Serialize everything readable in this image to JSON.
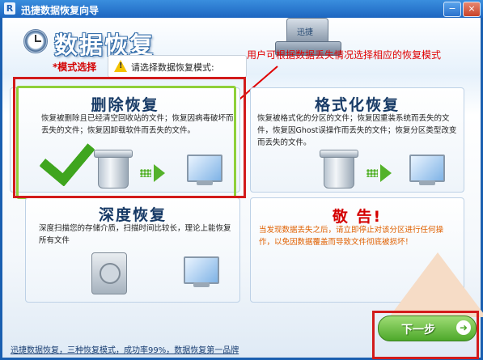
{
  "window": {
    "title": "迅捷数据恢复向导",
    "app_icon_letter": "R",
    "min_glyph": "−",
    "close_glyph": "×"
  },
  "header": {
    "title": "数据恢复",
    "mode_label": "*模式选择",
    "notice": "请选择数据恢复模式:",
    "drive_label": "迅捷"
  },
  "annotation": {
    "text": "用户可根据数据丢失情况选择相应的恢复模式",
    "color": "#e00000"
  },
  "cards": {
    "delete": {
      "title": "删除恢复",
      "desc": "恢复被删除且已经清空回收站的文件；恢复因病毒破坏而丢失的文件；恢复因卸载软件而丢失的文件。"
    },
    "format": {
      "title": "格式化恢复",
      "desc": "恢复被格式化的分区的文件；恢复因重装系统而丢失的文件，恢复因Ghost误操作而丢失的文件；恢复分区类型改变而丢失的文件。"
    },
    "deep": {
      "title": "深度恢复",
      "desc": "深度扫描您的存储介质，扫描时间比较长，理论上能恢复所有文件"
    },
    "warning": {
      "title": "敬 告!",
      "desc": "当发现数据丢失之后，请立即停止对该分区进行任何操作，以免因数据覆盖而导致文件彻底被损坏！"
    }
  },
  "footer": {
    "text": "迅捷数据恢复，三种恢复模式，成功率99%，数据恢复第一品牌",
    "next_label": "下一步",
    "next_arrow": "➜"
  },
  "colors": {
    "accent": "#1d66c0",
    "highlight": "#d21b1b",
    "selected_border": "#8fd03a"
  }
}
